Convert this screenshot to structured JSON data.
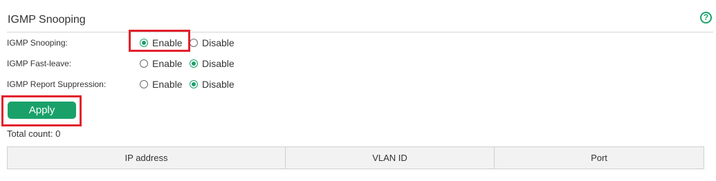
{
  "section": {
    "title": "IGMP Snooping",
    "help_icon": "?"
  },
  "settings": [
    {
      "label": "IGMP Snooping:",
      "options": [
        "Enable",
        "Disable"
      ],
      "selected": "Enable"
    },
    {
      "label": "IGMP Fast-leave:",
      "options": [
        "Enable",
        "Disable"
      ],
      "selected": "Disable"
    },
    {
      "label": "IGMP Report Suppression:",
      "options": [
        "Enable",
        "Disable"
      ],
      "selected": "Disable"
    }
  ],
  "actions": {
    "apply_label": "Apply"
  },
  "table": {
    "total_count": "Total count: 0",
    "columns": [
      "IP address",
      "VLAN ID",
      "Port"
    ],
    "rows": []
  },
  "colors": {
    "accent": "#1aa16a",
    "highlight": "#e3202c",
    "header_bg": "#f2f2f2"
  }
}
